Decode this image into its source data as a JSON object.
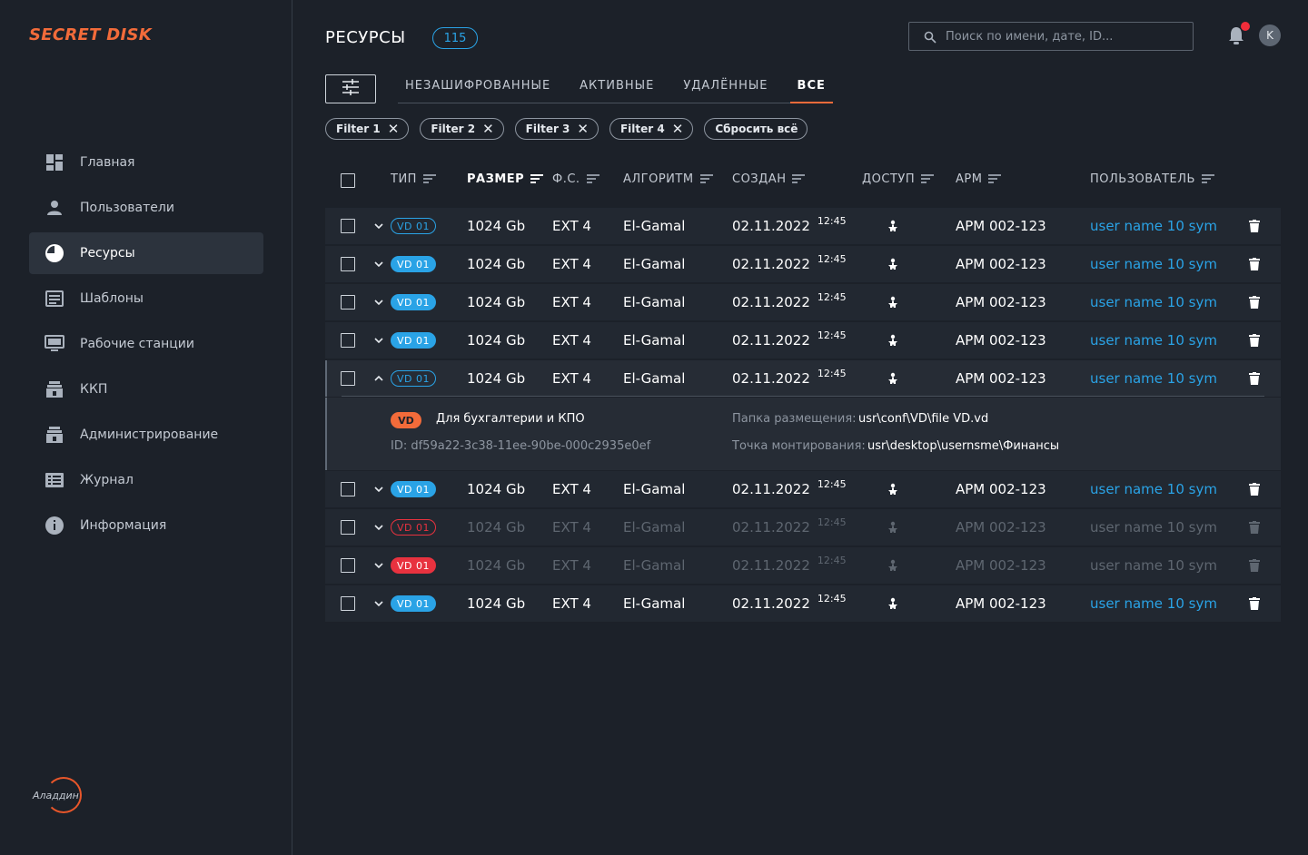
{
  "app": {
    "logo": "SECRET DISK",
    "vendor": "Аладдин"
  },
  "sidebar": {
    "items": [
      {
        "label": "Главная",
        "icon": "dashboard-icon"
      },
      {
        "label": "Пользователи",
        "icon": "user-icon"
      },
      {
        "label": "Ресурсы",
        "icon": "pie-chart-icon",
        "active": true
      },
      {
        "label": "Шаблоны",
        "icon": "template-icon"
      },
      {
        "label": "Рабочие станции",
        "icon": "monitor-icon"
      },
      {
        "label": "ККП",
        "icon": "lock-icon"
      },
      {
        "label": "Администрирование",
        "icon": "admin-lock-icon"
      },
      {
        "label": "Журнал",
        "icon": "journal-icon"
      },
      {
        "label": "Информация",
        "icon": "info-icon"
      }
    ]
  },
  "header": {
    "title": "РЕСУРСЫ",
    "count": "115",
    "search_placeholder": "Поиск по имени, дате, ID...",
    "avatar_letter": "K"
  },
  "tabs": [
    "НЕЗАШИФРОВАННЫЕ",
    "АКТИВНЫЕ",
    "УДАЛЁННЫЕ",
    "ВСЕ"
  ],
  "active_tab": "ВСЕ",
  "chips": [
    "Filter 1",
    "Filter 2",
    "Filter 3",
    "Filter 4"
  ],
  "reset_all": "Сбросить всё",
  "columns": [
    "ТИП",
    "РАЗМЕР",
    "Ф.С.",
    "АЛГОРИТМ",
    "СОЗДАН",
    "ДОСТУП",
    "АРМ",
    "ПОЛЬЗОВАТЕЛЬ"
  ],
  "sorted_column": "РАЗМЕР",
  "rows": [
    {
      "type": "VD 01",
      "badge": "outline-blue",
      "size": "1024 Gb",
      "fs": "EXT 4",
      "algo": "El-Gamal",
      "date": "02.11.2022",
      "time": "12:45",
      "arm": "АРМ 002-123",
      "user": "user name 10 sym",
      "dim": false,
      "expanded": false
    },
    {
      "type": "VD 01",
      "badge": "fill-blue",
      "size": "1024 Gb",
      "fs": "EXT 4",
      "algo": "El-Gamal",
      "date": "02.11.2022",
      "time": "12:45",
      "arm": "АРМ 002-123",
      "user": "user name 10 sym",
      "dim": false,
      "expanded": false
    },
    {
      "type": "VD 01",
      "badge": "fill-blue",
      "size": "1024 Gb",
      "fs": "EXT 4",
      "algo": "El-Gamal",
      "date": "02.11.2022",
      "time": "12:45",
      "arm": "АРМ 002-123",
      "user": "user name 10 sym",
      "dim": false,
      "expanded": false
    },
    {
      "type": "VD 01",
      "badge": "fill-blue",
      "size": "1024 Gb",
      "fs": "EXT 4",
      "algo": "El-Gamal",
      "date": "02.11.2022",
      "time": "12:45",
      "arm": "АРМ 002-123",
      "user": "user name 10 sym",
      "dim": false,
      "expanded": false
    },
    {
      "type": "VD 01",
      "badge": "outline-blue",
      "size": "1024 Gb",
      "fs": "EXT 4",
      "algo": "El-Gamal",
      "date": "02.11.2022",
      "time": "12:45",
      "arm": "АРМ 002-123",
      "user": "user name 10 sym",
      "dim": false,
      "expanded": true
    },
    {
      "type": "VD 01",
      "badge": "fill-blue",
      "size": "1024 Gb",
      "fs": "EXT 4",
      "algo": "El-Gamal",
      "date": "02.11.2022",
      "time": "12:45",
      "arm": "АРМ 002-123",
      "user": "user name 10 sym",
      "dim": false,
      "expanded": false
    },
    {
      "type": "VD 01",
      "badge": "outline-red",
      "size": "1024 Gb",
      "fs": "EXT 4",
      "algo": "El-Gamal",
      "date": "02.11.2022",
      "time": "12:45",
      "arm": "АРМ 002-123",
      "user": "user name 10 sym",
      "dim": true,
      "expanded": false
    },
    {
      "type": "VD 01",
      "badge": "fill-red",
      "size": "1024 Gb",
      "fs": "EXT 4",
      "algo": "El-Gamal",
      "date": "02.11.2022",
      "time": "12:45",
      "arm": "АРМ 002-123",
      "user": "user name 10 sym",
      "dim": true,
      "expanded": false
    },
    {
      "type": "VD 01",
      "badge": "fill-blue",
      "size": "1024 Gb",
      "fs": "EXT 4",
      "algo": "El-Gamal",
      "date": "02.11.2022",
      "time": "12:45",
      "arm": "АРМ 002-123",
      "user": "user name 10 sym",
      "dim": false,
      "expanded": false
    }
  ],
  "detail": {
    "tag": "VD",
    "name": "Для бухгалтерии и КПО",
    "id": "ID: df59a22-3c38-11ee-90be-000c2935e0ef",
    "folder_label": "Папка размещения:",
    "folder_value": "usr\\conf\\VD\\file VD.vd",
    "mount_label": "Точка монтирования:",
    "mount_value": "usr\\desktop\\usernsme\\Финансы"
  },
  "colors": {
    "accent": "#f26b3a",
    "link": "#2aa3e6",
    "danger": "#e8323f",
    "bg": "#1c2129"
  }
}
